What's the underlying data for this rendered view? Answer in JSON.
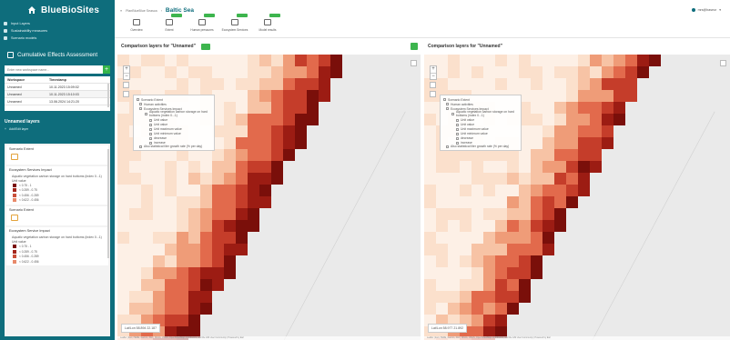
{
  "app": {
    "title": "BlueBioSites"
  },
  "sidebar": {
    "nav": [
      {
        "label": "Input Layers"
      },
      {
        "label": "Sustainability measures"
      },
      {
        "label": "Scenario models"
      }
    ],
    "cea_title": "Cumulative Effects Assessment",
    "search_placeholder": "Enter new workspace name...",
    "add_symbol": "+",
    "table": {
      "headers": [
        "Workspace",
        "Timestamp"
      ],
      "rows": [
        [
          "Unnamed",
          "10.11.2023 15:09:02"
        ],
        [
          "Unnamed",
          "10.11.2023 15:10:03"
        ],
        [
          "Unnamed",
          "13.06.2024 14:21:20"
        ]
      ]
    },
    "layers_title": "Unnamed layers",
    "add_edit": "Add/Edit layer",
    "layer_panel": {
      "sections": [
        {
          "title": "Scenario Extent"
        },
        {
          "title": "Ecosystem Services Impact",
          "text": "Aquatic vegetation carbon storage on hard bottoms (index 0...1)",
          "unit": "Unit value",
          "legend": [
            "< 0.75 - 1",
            "< 0.289 - 0.75",
            "< 0.456 - 0.289",
            "< 0.622 - 0.456"
          ]
        },
        {
          "title": "Scenario Extent"
        },
        {
          "title": "Ecosystem Service Impact",
          "text": "Aquatic vegetation carbon storage on hard bottoms (index 0...1)",
          "unit": "Unit value",
          "legend": [
            "< 0.75 - 1",
            "< 0.289 - 0.75",
            "< 0.456 - 0.289",
            "< 0.622 - 0.456"
          ]
        }
      ]
    }
  },
  "topbar": {
    "crumb": "PlanBlueBlue Seasca",
    "sea": "Baltic Sea",
    "user": "mrs@baseur",
    "tools": [
      {
        "label": "Overview",
        "badge": false
      },
      {
        "label": "Extent",
        "badge": true
      },
      {
        "label": "Human pressures",
        "badge": true
      },
      {
        "label": "Ecosystem Services",
        "badge": true
      },
      {
        "label": "Model results",
        "badge": true
      }
    ]
  },
  "panes": [
    {
      "title": "Comparison layers for \"Unnamed\"",
      "latlon": "Lat/Lon 58.894 22.187",
      "attrib": "Leaflet | Esri, HERE, Garmin, FAO, NOAA, USGS, OpenStreetMap contributors, and the GIS User Community | Powered by Esri"
    },
    {
      "title": "Comparison layers for \"Unnamed\"",
      "latlon": "Lat/Lon 58.977 21.892",
      "attrib": "Leaflet | Esri, HERE, Garmin, FAO, NOAA, USGS, OpenStreetMap contributors, and the GIS User Community | Powered by Esri"
    }
  ],
  "tree": {
    "rows": [
      "Scenario Extent",
      "Human activities",
      "Ecosystem Services Impact",
      "Aquatic vegetation carbon storage on hard bottoms (index 0...1)",
      "Unit value",
      "Unit value",
      "Unit maximum value",
      "Unit minimum value",
      "decrease",
      "increase",
      "Also statistical liter growth rate (% per day)"
    ]
  },
  "colors": {
    "sidebar": "#0e6d7c",
    "accent_green": "#3db54e",
    "sea_light": "#fbe4d2",
    "sea_dark": "#7a0f0a",
    "land": "#e6e6e6"
  }
}
